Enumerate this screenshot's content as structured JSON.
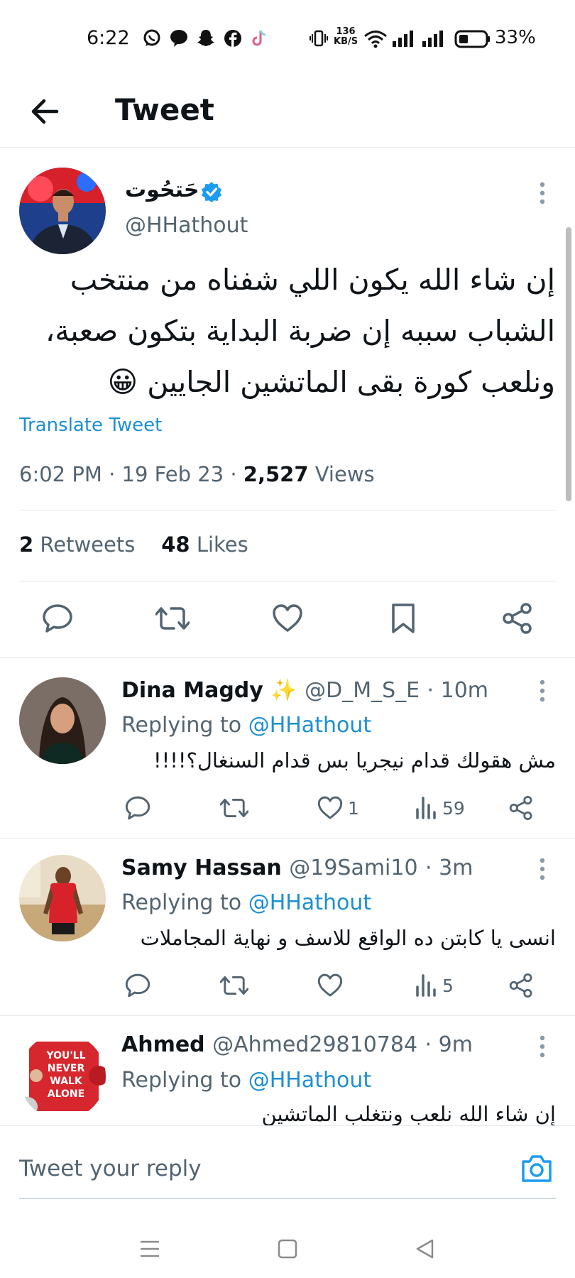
{
  "status_bar": {
    "time": "6:22",
    "speed_value": "136",
    "speed_unit": "KB/S",
    "battery": "33%",
    "icons": [
      "whatsapp-icon",
      "messenger-icon",
      "snapchat-icon",
      "facebook-icon",
      "tiktok-icon",
      "vibrate-icon",
      "wifi-icon",
      "signal-icon",
      "battery-icon"
    ]
  },
  "header": {
    "title": "Tweet"
  },
  "tweet": {
    "author_name": "حَتحُوت",
    "handle": "@HHathout",
    "text_lines": [
      "إن شاء الله يكون اللي شفناه من منتخب",
      "الشباب سببه إن ضربة البداية بتكون صعبة،",
      "ونلعب كورة بقى الماتشين الجايين 😀"
    ],
    "translate_label": "Translate Tweet",
    "time": "6:02 PM",
    "date": "19 Feb 23",
    "separator": "·",
    "views_count": "2,527",
    "views_label": "Views",
    "retweets_count": "2",
    "retweets_label": "Retweets",
    "likes_count": "48",
    "likes_label": "Likes"
  },
  "replies": [
    {
      "name": "Dina Magdy ✨",
      "handle": "@D_M_S_E",
      "time": "· 10m",
      "replying_prefix": "Replying to",
      "replying_to": "@HHathout",
      "text": "مش هقولك قدام نيجريا بس قدام السنغال؟!!!!",
      "likes": "1",
      "views": "59"
    },
    {
      "name": "Samy Hassan",
      "handle": "@19Sami10",
      "time": "· 3m",
      "replying_prefix": "Replying to",
      "replying_to": "@HHathout",
      "text": "انسى يا كابتن ده الواقع للاسف و نهاية المجاملات",
      "likes": "",
      "views": "5"
    },
    {
      "name": "Ahmed",
      "handle": "@Ahmed29810784",
      "time": "· 9m",
      "replying_prefix": "Replying to",
      "replying_to": "@HHathout",
      "text": "إن شاء الله نلعب ونتغلب الماتشين",
      "avatar_text": [
        "YOU'LL",
        "NEVER",
        "WALK",
        "ALONE"
      ]
    }
  ],
  "composer": {
    "placeholder": "Tweet your reply"
  },
  "colors": {
    "accent": "#1d9bf0",
    "link": "#1d8fd1",
    "muted": "#536471",
    "text": "#0f1419"
  }
}
